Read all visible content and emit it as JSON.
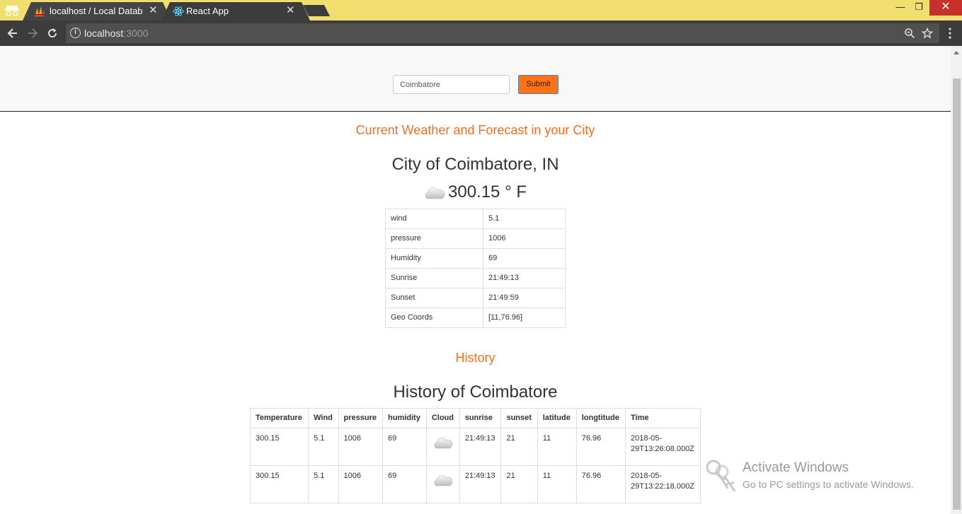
{
  "browser": {
    "tabs": [
      {
        "title": "localhost / Local Databas",
        "favicon": "phpmyadmin-icon",
        "active": false
      },
      {
        "title": "React App",
        "favicon": "react-icon",
        "active": true
      }
    ],
    "window_controls": {
      "minimize": "—",
      "restore": "❐",
      "close": "✕"
    },
    "url_host": "localhost",
    "url_port": ":3000",
    "colors": {
      "tabbar": "#f0df6e",
      "toolbar": "#3c3c3c"
    }
  },
  "search": {
    "input_value": "Coimbatore",
    "submit_label": "Submit"
  },
  "current": {
    "heading": "Current Weather and Forecast in your City",
    "city_title": "City of Coimbatore, IN",
    "weather_icon": "cloud-icon",
    "temperature": "300.15 ° F",
    "rows": [
      {
        "key": "wind",
        "value": "5.1"
      },
      {
        "key": "pressure",
        "value": "1006"
      },
      {
        "key": "Humidity",
        "value": "69"
      },
      {
        "key": "Sunrise",
        "value": "21:49:13"
      },
      {
        "key": "Sunset",
        "value": "21:49:59"
      },
      {
        "key": "Geo Coords",
        "value": "[11,76.96]"
      }
    ]
  },
  "history": {
    "heading": "History",
    "title": "History of Coimbatore",
    "columns": [
      "Temperature",
      "Wind",
      "pressure",
      "humidity",
      "Cloud",
      "sunrise",
      "sunset",
      "latitude",
      "longtitude",
      "Time"
    ],
    "rows": [
      {
        "temperature": "300.15",
        "wind": "5.1",
        "pressure": "1006",
        "humidity": "69",
        "cloud": "cloud-icon",
        "sunrise": "21:49:13",
        "sunset": "21",
        "latitude": "11",
        "longitude": "76.96",
        "time": "2018-05-29T13:26:08.000Z"
      },
      {
        "temperature": "300.15",
        "wind": "5.1",
        "pressure": "1006",
        "humidity": "69",
        "cloud": "cloud-icon",
        "sunrise": "21:49:13",
        "sunset": "21",
        "latitude": "11",
        "longitude": "76.96",
        "time": "2018-05-29T13:22:18.000Z"
      }
    ]
  },
  "watermark": {
    "line1": "Activate Windows",
    "line2": "Go to PC settings to activate Windows."
  },
  "theme": {
    "accent": "#f36f21",
    "button": "#ff7216"
  }
}
